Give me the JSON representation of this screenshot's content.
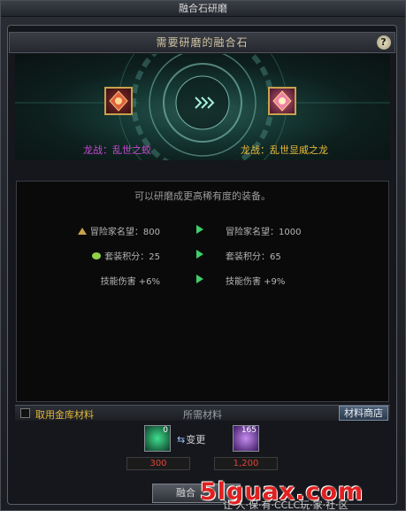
{
  "window": {
    "title": "融合石研磨"
  },
  "header": {
    "title": "需要研磨的融合石"
  },
  "items": {
    "left_name": "龙战：乱世之蛟",
    "right_name": "龙战：乱世显威之龙"
  },
  "stats": {
    "subtitle": "可以研磨成更高稀有度的装备。",
    "rows": [
      {
        "left": "冒险家名望：800",
        "right": "冒险家名望：1000"
      },
      {
        "left": "套装积分：25",
        "right": "套装积分：65"
      },
      {
        "left": "技能伤害 +6%",
        "right": "技能伤害 +9%"
      }
    ]
  },
  "materials": {
    "checkbox_label": "取用金库材料",
    "title": "所需材料",
    "shop_button": "材料商店",
    "swap_label": "变更",
    "slot_a_count": "0",
    "slot_b_count": "165",
    "price_a": "300",
    "price_b": "1,200"
  },
  "actions": {
    "polish_button": "融合"
  },
  "watermark": {
    "text": "5lguax.com",
    "sub": "让·人·保·有·CCLC玩·家·社·区"
  },
  "colors": {
    "item_purple": "#c64bd1",
    "item_gold": "#e8b93a",
    "material_gold": "#e0b73a",
    "arrow_green": "#3fcf6a",
    "price_red": "#e0453a"
  }
}
